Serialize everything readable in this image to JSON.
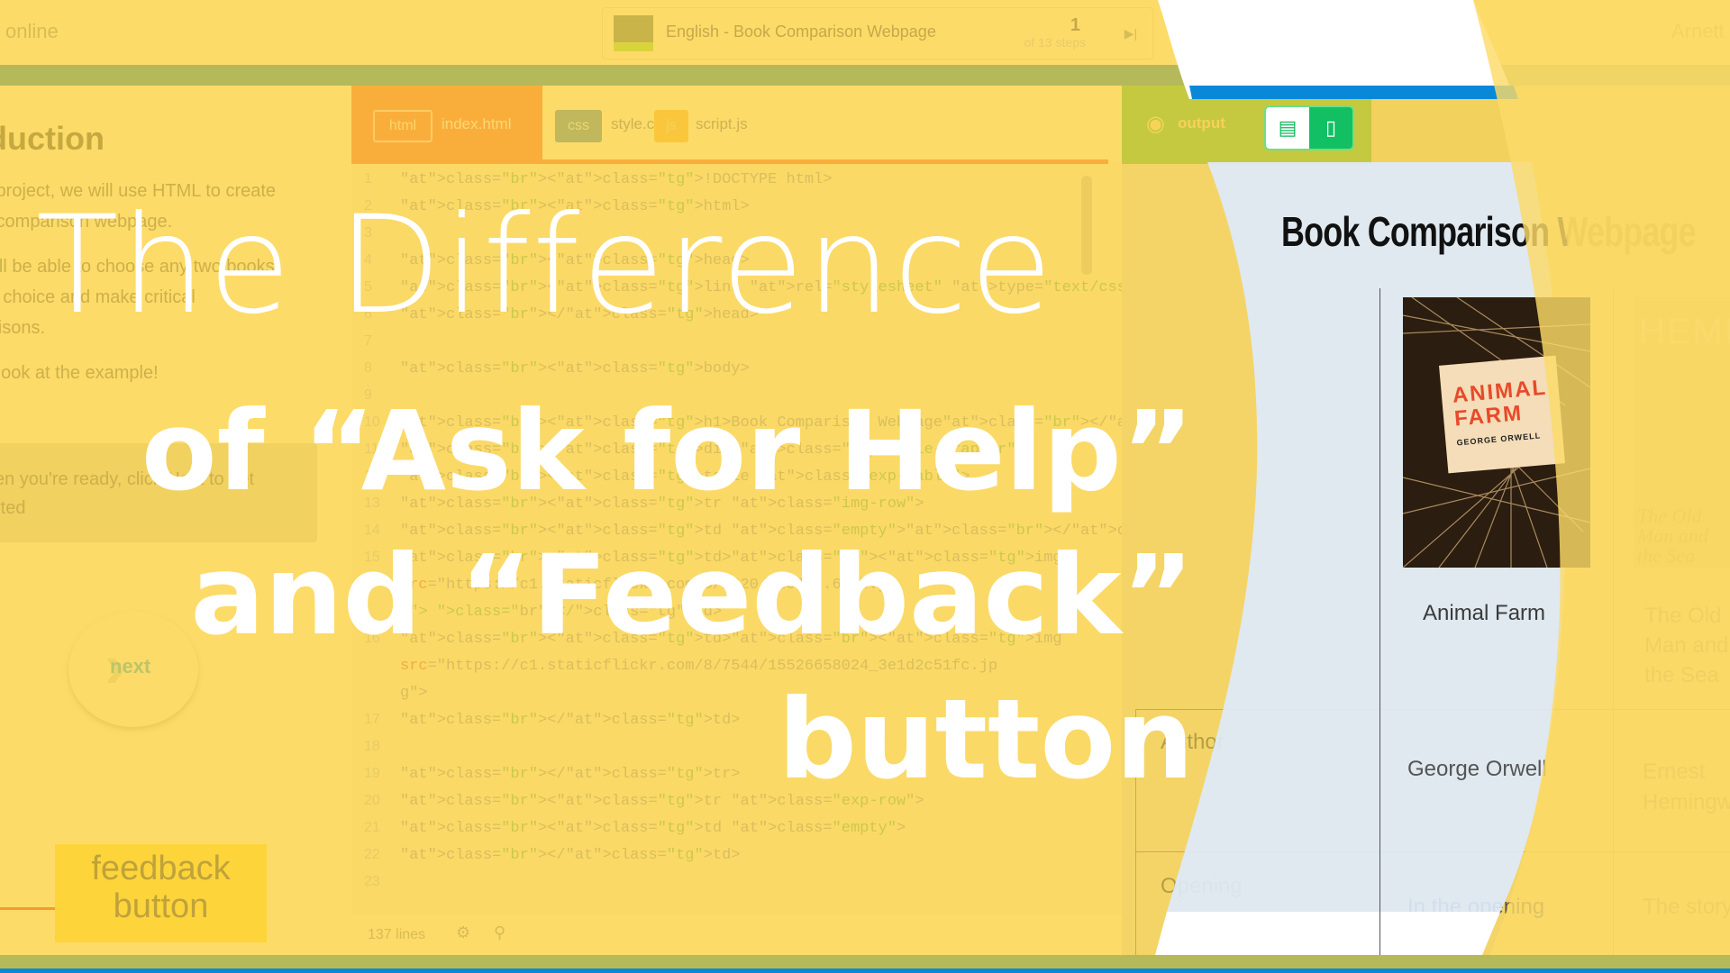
{
  "topbar": {
    "status": "online",
    "course_title": "English - Book Comparison Webpage",
    "step_current": "1",
    "step_total_label": "of 13 steps",
    "skip_icon": "skip-forward-icon",
    "user_name": "Arnett"
  },
  "lesson": {
    "title": "roduction",
    "paragraphs": [
      "s project, we will use HTML to create",
      "k comparison webpage.",
      "will be able to choose any two books",
      "ur choice and make critical",
      "arisons.",
      "a look at the example!"
    ],
    "hint": [
      "en you're ready, click Next to get",
      "rted"
    ],
    "next_label": "next",
    "feedback_label": "feedback button"
  },
  "editor": {
    "tabs": [
      {
        "badge": "html",
        "name": "index.html",
        "active": true
      },
      {
        "badge": "css",
        "name": "style.css",
        "active": false
      },
      {
        "badge": "js",
        "name": "script.js",
        "active": false
      }
    ],
    "lines": [
      {
        "n": "1",
        "code": "<!DOCTYPE html>"
      },
      {
        "n": "2",
        "code": "<html>"
      },
      {
        "n": "3",
        "code": ""
      },
      {
        "n": "4",
        "code": "<head>"
      },
      {
        "n": "5",
        "code": "    <link rel=\"stylesheet\" type=\"text/css\" href=\"style.css\" />"
      },
      {
        "n": "6",
        "code": "</head>"
      },
      {
        "n": "7",
        "code": ""
      },
      {
        "n": "8",
        "code": "<body>"
      },
      {
        "n": "9",
        "code": ""
      },
      {
        "n": "10",
        "code": "    <h1>Book Comparison Webpage</h1>"
      },
      {
        "n": "11",
        "code": "    <div class=\"exp-table-wrapper\">"
      },
      {
        "n": "12",
        "code": "        <table class=\"exp-table\">"
      },
      {
        "n": "13",
        "code": "            <tr class=\"img-row\">"
      },
      {
        "n": "14",
        "code": "                <td class=\"empty\"></td>"
      },
      {
        "n": "15",
        "code": "                <td><img"
      },
      {
        "n": "",
        "code": "src=\"https://c1.staticflickr.com/3/2320/2237...62_b.j"
      },
      {
        "n": "",
        "code": "g\"> </td>"
      },
      {
        "n": "16",
        "code": "                <td><img"
      },
      {
        "n": "",
        "code": "src=\"https://c1.staticflickr.com/8/7544/15526658024_3e1d2c51fc.jp"
      },
      {
        "n": "",
        "code": "g\">"
      },
      {
        "n": "17",
        "code": "                </td>"
      },
      {
        "n": "18",
        "code": ""
      },
      {
        "n": "19",
        "code": "            </tr>"
      },
      {
        "n": "20",
        "code": "            <tr class=\"exp-row\">"
      },
      {
        "n": "21",
        "code": "                <td class=\"empty\">"
      },
      {
        "n": "22",
        "code": "                </td>"
      },
      {
        "n": "23",
        "code": ""
      }
    ],
    "line_count": "137 lines"
  },
  "output": {
    "label": "output",
    "view_modes": [
      "desktop",
      "mobile"
    ],
    "active_view": "desktop",
    "page_heading": "Book Comparison Webpage",
    "books": [
      {
        "title": "Animal Farm",
        "author": "George Orwell",
        "opening": "In the opening",
        "cover_title": "ANIMAL FARM",
        "cover_author": "GEORGE ORWELL"
      },
      {
        "title": "The Old Man and the Sea",
        "author": "Ernest Hemingway",
        "opening": "The story",
        "cover_title": "The Old Man and the Sea",
        "cover_author": "HEMINGWAY"
      }
    ],
    "row_labels": [
      "Author",
      "Opening"
    ]
  },
  "headline": {
    "line1": "The Difference",
    "line2": "of “Ask for Help”",
    "line3": "and “Feedback”",
    "line4": "button"
  },
  "colors": {
    "overlay_yellow": "#FDDB68",
    "olive": "#B5B95A",
    "accent_orange": "#F9AE3B",
    "output_green": "#12C063",
    "blue": "#0A88D8",
    "stripe_white": "#FFFFFF",
    "stripe_light_blue": "#DCEAFB"
  }
}
